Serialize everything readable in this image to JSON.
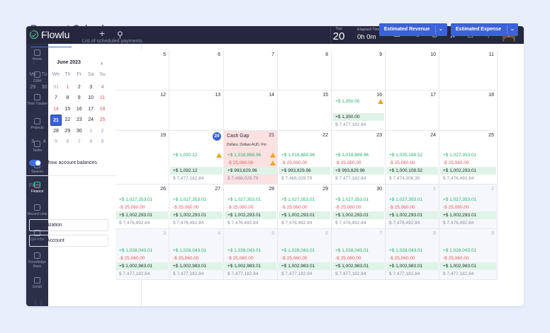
{
  "app": {
    "name": "Flowlu"
  },
  "topbar": {
    "day": "Tue",
    "date": "20",
    "elapsed_label": "Elapsed Time",
    "elapsed_value": "0h 0m",
    "notif_count": "34"
  },
  "sidebar": [
    {
      "label": "Home",
      "icon": "home-icon"
    },
    {
      "label": "CRM",
      "icon": "crm-icon"
    },
    {
      "label": "Time Tracker",
      "icon": "time-tracker-icon"
    },
    {
      "label": "Projects",
      "icon": "projects-icon"
    },
    {
      "label": "Tasks",
      "icon": "tasks-icon"
    },
    {
      "label": "Spaces",
      "icon": "spaces-icon"
    },
    {
      "label": "Finance",
      "icon": "finance-icon",
      "active": true
    },
    {
      "label": "Record Lists",
      "icon": "record-lists-icon"
    },
    {
      "label": "Calendar",
      "icon": "calendar-icon"
    },
    {
      "label": "Knowledge Base",
      "icon": "knowledge-base-icon"
    },
    {
      "label": "Email",
      "icon": "email-icon"
    }
  ],
  "page": {
    "title": "Payment Calendar",
    "tabs": [
      "Payment Calendar",
      "List of scheduled payments"
    ]
  },
  "buttons": {
    "revenue": "Estimated Revenue",
    "expense": "Estimated Expense"
  },
  "mini_calendar": {
    "title": "June 2023",
    "weekdays": [
      "Mo",
      "Tu",
      "We",
      "Th",
      "Fr",
      "Sa",
      "Su"
    ],
    "weeks": [
      [
        "29",
        "30",
        "31",
        "1",
        "2",
        "3",
        "4"
      ],
      [
        "5",
        "6",
        "7",
        "8",
        "9",
        "10",
        "11"
      ],
      [
        "12",
        "13",
        "14",
        "15",
        "16",
        "17",
        "18"
      ],
      [
        "19",
        "20",
        "21",
        "22",
        "23",
        "24",
        "25"
      ],
      [
        "26",
        "27",
        "28",
        "29",
        "30",
        "1",
        "2"
      ],
      [
        "3",
        "4",
        "5",
        "6",
        "7",
        "8",
        "9"
      ]
    ],
    "selected": "21"
  },
  "toggle_label": "Show account balances",
  "filter": {
    "label": "Filter",
    "fields": [
      "Organization",
      "Bank Account"
    ]
  },
  "calendar": {
    "rows": [
      [
        {
          "day": "5"
        },
        {
          "day": "6"
        },
        {
          "day": "7"
        },
        {
          "day": "8"
        },
        {
          "day": "9"
        },
        {
          "day": "10"
        },
        {
          "day": "11"
        }
      ],
      [
        {
          "day": "12"
        },
        {
          "day": "13"
        },
        {
          "day": "14"
        },
        {
          "day": "15"
        },
        {
          "day": "16",
          "inc": "+$ 1,350.00",
          "bal": "+$ 1,350.00",
          "tot": "$ 7,477,182.84",
          "warn": "in"
        },
        {
          "day": "17"
        },
        {
          "day": "18"
        }
      ],
      [
        {
          "day": "19"
        },
        {
          "day": "20",
          "today": true,
          "inc": "+$ 1,092.12",
          "bal": "+$ 1,092.12",
          "tot": "$ 7,477,182.84",
          "warn": "in"
        },
        {
          "day": "21",
          "gap": true,
          "gap_title": "Cash Gap",
          "gap_sub": "Dollars, Dollars AUD, Por",
          "inc": "+$ 1,018,889.96",
          "out": "-$ 25,060.00",
          "bal": "+$ 993,829.96",
          "tot": "$ 7,468,029.79",
          "warn": "both"
        },
        {
          "day": "22",
          "inc": "+$ 1,018,889.96",
          "out": "-$ 25,060.00",
          "bal": "+$ 993,829.96",
          "tot": "$ 7,468,029.79"
        },
        {
          "day": "23",
          "inc": "+$ 1,018,889.96",
          "out": "-$ 25,060.00",
          "bal": "+$ 993,829.96",
          "tot": "$ 7,477,182.84"
        },
        {
          "day": "24",
          "inc": "+$ 1,025,188.52",
          "out": "-$ 25,060.00",
          "bal": "+$ 1,000,108.52",
          "tot": "$ 7,474,308.35"
        },
        {
          "day": "25",
          "inc": "+$ 1,027,353.01",
          "out": "-$ 25,060.00",
          "bal": "+$ 1,002,293.01",
          "tot": "$ 7,476,492.84"
        }
      ],
      [
        {
          "day": "26",
          "inc": "+$ 1,027,353.01",
          "out": "-$ 25,060.00",
          "bal": "+$ 1,002,293.01",
          "tot": "$ 7,476,492.84"
        },
        {
          "day": "27",
          "inc": "+$ 1,027,353.01",
          "out": "-$ 25,060.00",
          "bal": "+$ 1,002,293.01",
          "tot": "$ 7,476,492.84"
        },
        {
          "day": "28",
          "inc": "+$ 1,027,353.01",
          "out": "-$ 25,060.00",
          "bal": "+$ 1,002,293.01",
          "tot": "$ 7,476,492.84"
        },
        {
          "day": "29",
          "inc": "+$ 1,027,353.01",
          "out": "-$ 25,060.00",
          "bal": "+$ 1,002,293.01",
          "tot": "$ 7,476,492.84"
        },
        {
          "day": "30",
          "inc": "+$ 1,027,353.01",
          "out": "-$ 25,060.00",
          "bal": "+$ 1,002,293.01",
          "tot": "$ 7,476,492.84"
        },
        {
          "day": "1",
          "other": true,
          "inc": "+$ 1,027,353.01",
          "out": "-$ 25,060.00",
          "bal": "+$ 1,002,293.01",
          "tot": "$ 7,476,492.84"
        },
        {
          "day": "2",
          "other": true,
          "inc": "+$ 1,027,353.01",
          "out": "-$ 25,060.00",
          "bal": "+$ 1,002,293.01",
          "tot": "$ 7,476,492.84"
        }
      ],
      [
        {
          "day": "3",
          "other": true,
          "inc": "+$ 1,028,043.01",
          "out": "-$ 25,060.00",
          "bal": "+$ 1,002,983.01",
          "tot": "$ 7,477,182.84"
        },
        {
          "day": "4",
          "other": true,
          "inc": "+$ 1,028,043.01",
          "out": "-$ 25,060.00",
          "bal": "+$ 1,002,983.01",
          "tot": "$ 7,477,182.84"
        },
        {
          "day": "5",
          "other": true,
          "inc": "+$ 1,028,043.01",
          "out": "-$ 25,060.00",
          "bal": "+$ 1,002,983.01",
          "tot": "$ 7,477,182.84"
        },
        {
          "day": "6",
          "other": true,
          "inc": "+$ 1,028,043.01",
          "out": "-$ 25,060.00",
          "bal": "+$ 1,002,983.01",
          "tot": "$ 7,477,182.84"
        },
        {
          "day": "7",
          "other": true,
          "inc": "+$ 1,028,043.01",
          "out": "-$ 25,060.00",
          "bal": "+$ 1,002,983.01",
          "tot": "$ 7,477,182.84"
        },
        {
          "day": "8",
          "other": true,
          "inc": "+$ 1,028,043.01",
          "out": "-$ 25,060.00",
          "bal": "+$ 1,002,983.01",
          "tot": "$ 7,477,182.84"
        },
        {
          "day": "9",
          "other": true,
          "inc": "+$ 1,028,043.01",
          "out": "-$ 25,060.00",
          "bal": "+$ 1,002,983.01",
          "tot": "$ 7,477,182.84"
        }
      ]
    ]
  }
}
